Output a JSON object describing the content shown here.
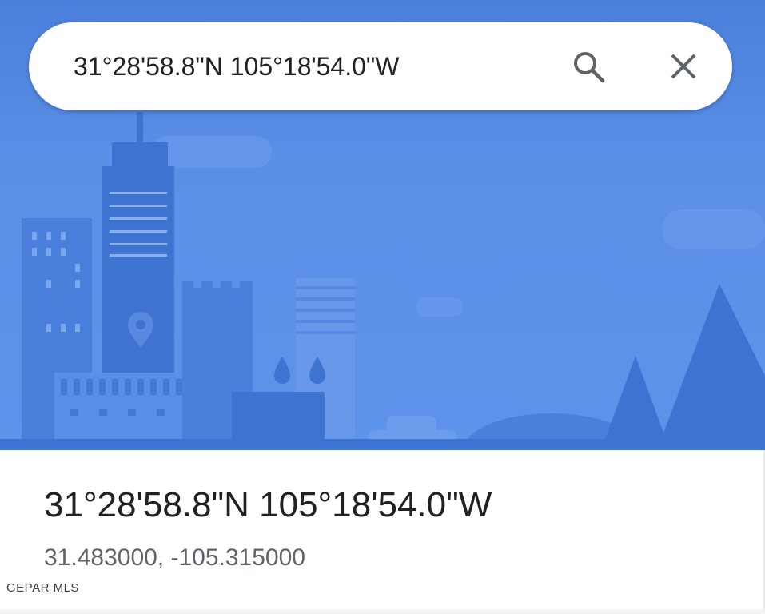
{
  "search": {
    "query": "31°28'58.8\"N 105°18'54.0\"W",
    "search_icon": "search-icon",
    "close_icon": "close-icon"
  },
  "place": {
    "title": "31°28'58.8\"N 105°18'54.0\"W",
    "decimal_coordinates": "31.483000, -105.315000"
  },
  "watermark": "GEPAR MLS",
  "colors": {
    "sky": "#5b8fe6",
    "building": "#4277d6",
    "ground": "#3e73d4",
    "search_bg": "#ffffff",
    "text_primary": "#202124",
    "text_secondary": "#5f6368"
  },
  "illustration": {
    "name": "city-skyline-illustration",
    "pin_icon": "location-pin-icon"
  }
}
